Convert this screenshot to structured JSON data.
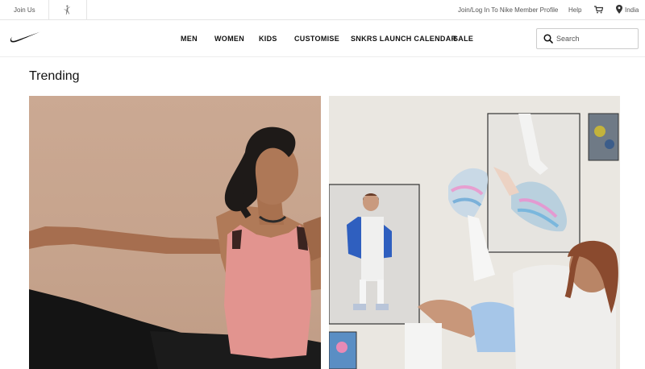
{
  "utility_bar": {
    "join_us": "Join Us",
    "login": "Join/Log In To Nike Member Profile",
    "help": "Help",
    "country": "India"
  },
  "nav": {
    "items": [
      "MEN",
      "WOMEN",
      "KIDS",
      "CUSTOMISE",
      "SNKRS LAUNCH CALENDAR",
      "SALE"
    ]
  },
  "search": {
    "placeholder": "Search"
  },
  "section": {
    "title": "Trending"
  },
  "icons": {
    "brand_logo": "nike-swoosh-icon",
    "jordan": "jordan-jumpman-icon",
    "cart": "cart-icon",
    "location": "location-pin-icon",
    "search": "search-icon"
  },
  "colors": {
    "text": "#111111",
    "muted": "#555555",
    "border": "#e5e5e5"
  }
}
